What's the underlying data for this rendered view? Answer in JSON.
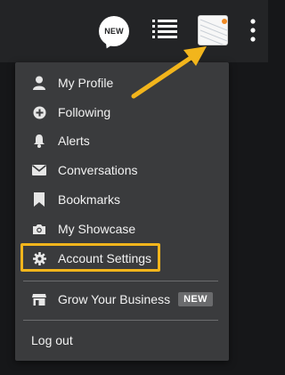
{
  "header": {
    "new_badge_label": "NEW",
    "icons": [
      "new-posts-icon",
      "list-icon",
      "avatar-thumbnail",
      "more-vertical-icon"
    ]
  },
  "menu": {
    "items": [
      {
        "label": "My Profile",
        "icon": "user-icon"
      },
      {
        "label": "Following",
        "icon": "plus-circle-icon"
      },
      {
        "label": "Alerts",
        "icon": "bell-icon"
      },
      {
        "label": "Conversations",
        "icon": "envelope-icon"
      },
      {
        "label": "Bookmarks",
        "icon": "bookmark-icon"
      },
      {
        "label": "My Showcase",
        "icon": "camera-icon"
      },
      {
        "label": "Account Settings",
        "icon": "gear-icon"
      }
    ],
    "business": {
      "label": "Grow Your Business",
      "badge": "NEW",
      "icon": "storefront-icon"
    },
    "logout_label": "Log out"
  },
  "colors": {
    "highlight": "#f2b51c",
    "menu_bg": "#3a3b3d",
    "topbar_bg": "#232426"
  }
}
